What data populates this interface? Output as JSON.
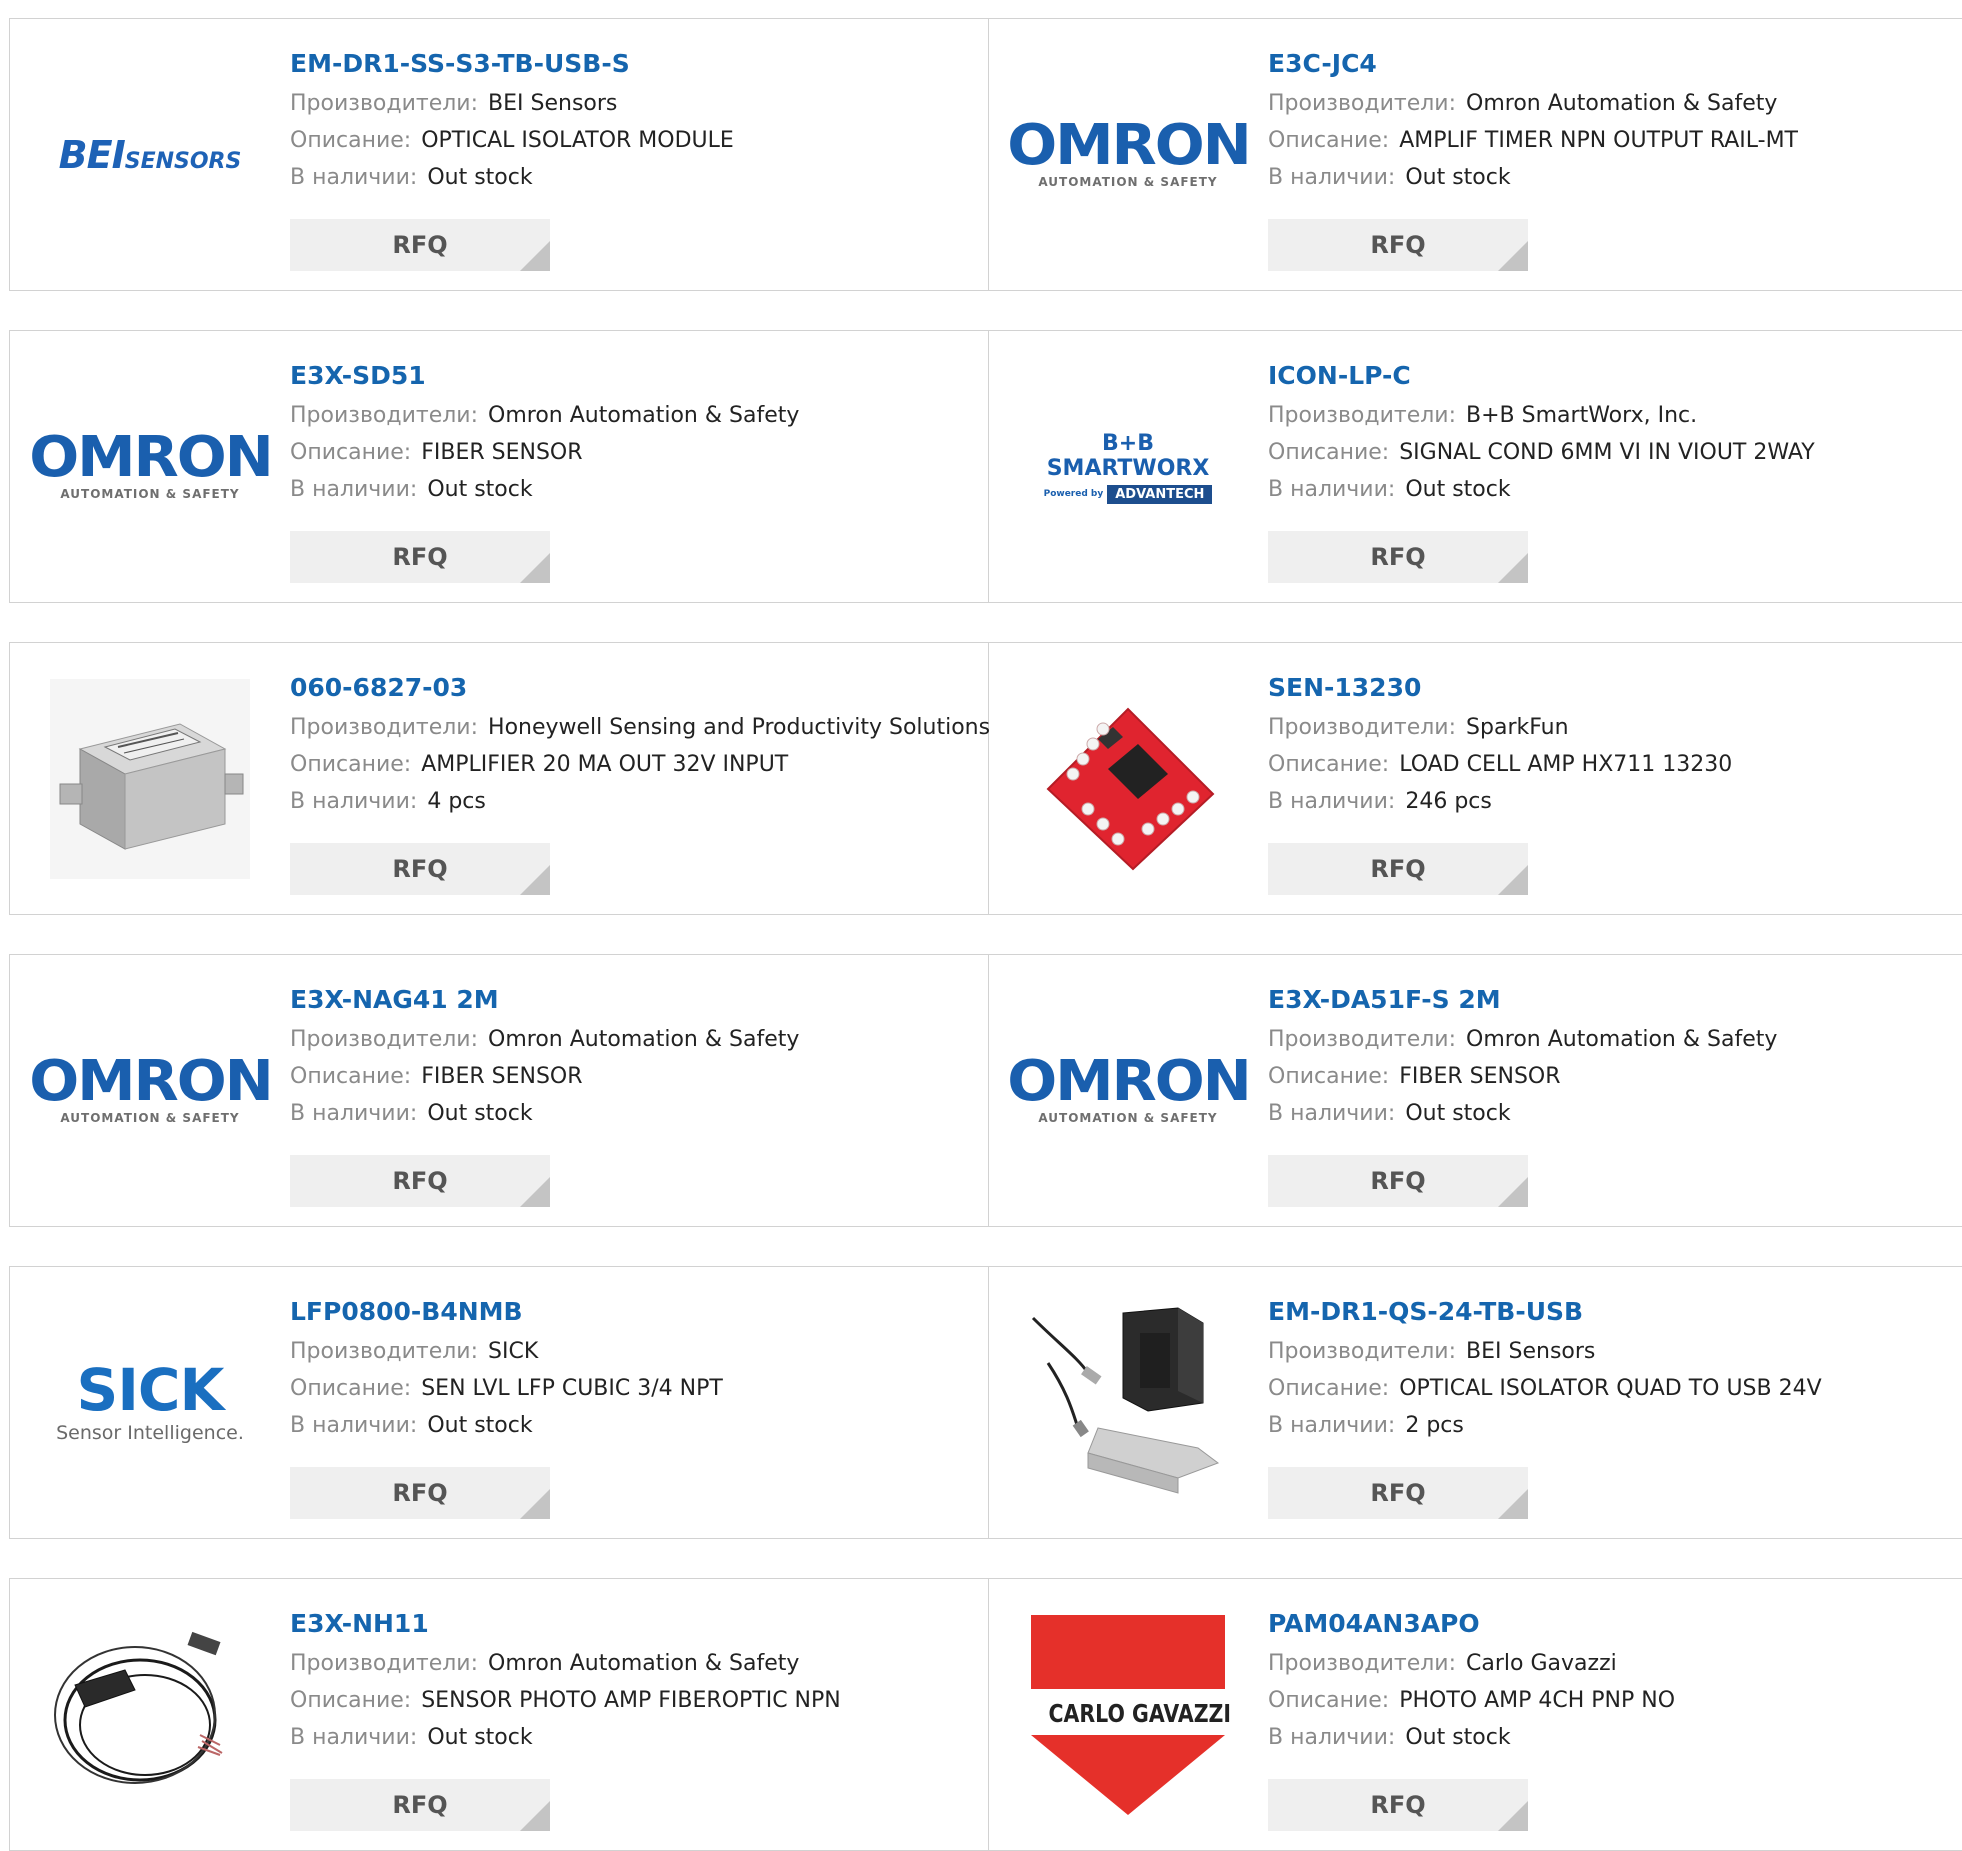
{
  "labels": {
    "manufacturer": "Производители:",
    "description": "Описание:",
    "stock": "В наличии:",
    "rfq": "RFQ"
  },
  "products": [
    {
      "part": "EM-DR1-SS-S3-TB-USB-S",
      "manufacturer": "BEI Sensors",
      "description": "OPTICAL ISOLATOR MODULE",
      "stock": "Out stock",
      "logo": "bei-sensors-logo",
      "logo_text": [
        "BEI",
        "SENSORS"
      ]
    },
    {
      "part": "E3C-JC4",
      "manufacturer": "Omron Automation & Safety",
      "description": "AMPLIF TIMER NPN OUTPUT RAIL-MT",
      "stock": "Out stock",
      "logo": "omron-logo",
      "logo_text": [
        "OMRON",
        "AUTOMATION & SAFETY"
      ]
    },
    {
      "part": "E3X-SD51",
      "manufacturer": "Omron Automation & Safety",
      "description": "FIBER SENSOR",
      "stock": "Out stock",
      "logo": "omron-logo",
      "logo_text": [
        "OMRON",
        "AUTOMATION & SAFETY"
      ]
    },
    {
      "part": "ICON-LP-C",
      "manufacturer": "B+B SmartWorx, Inc.",
      "description": "SIGNAL COND 6MM VI IN VIOUT 2WAY",
      "stock": "Out stock",
      "logo": "bb-smartworx-logo",
      "logo_text": [
        "B+B SMARTWORX",
        "Powered by",
        "ADVANTECH"
      ]
    },
    {
      "part": "060-6827-03",
      "manufacturer": "Honeywell Sensing and Productivity Solutions",
      "description": "AMPLIFIER 20 MA OUT 32V INPUT",
      "stock": "4 pcs",
      "logo": "junction-box-image",
      "logo_text": []
    },
    {
      "part": "SEN-13230",
      "manufacturer": "SparkFun",
      "description": "LOAD CELL AMP HX711 13230",
      "stock": "246 pcs",
      "logo": "red-pcb-board-image",
      "logo_text": []
    },
    {
      "part": "E3X-NAG41 2M",
      "manufacturer": "Omron Automation & Safety",
      "description": "FIBER SENSOR",
      "stock": "Out stock",
      "logo": "omron-logo",
      "logo_text": [
        "OMRON",
        "AUTOMATION & SAFETY"
      ]
    },
    {
      "part": "E3X-DA51F-S 2M",
      "manufacturer": "Omron Automation & Safety",
      "description": "FIBER SENSOR",
      "stock": "Out stock",
      "logo": "omron-logo",
      "logo_text": [
        "OMRON",
        "AUTOMATION & SAFETY"
      ]
    },
    {
      "part": "LFP0800-B4NMB",
      "manufacturer": "SICK",
      "description": "SEN LVL LFP CUBIC 3/4 NPT",
      "stock": "Out stock",
      "logo": "sick-logo",
      "logo_text": [
        "SICK",
        "Sensor Intelligence."
      ]
    },
    {
      "part": "EM-DR1-QS-24-TB-USB",
      "manufacturer": "BEI Sensors",
      "description": "OPTICAL ISOLATOR QUAD TO USB 24V",
      "stock": "2 pcs",
      "logo": "din-rail-module-image",
      "logo_text": []
    },
    {
      "part": "E3X-NH11",
      "manufacturer": "Omron Automation & Safety",
      "description": "SENSOR PHOTO AMP FIBEROPTIC NPN",
      "stock": "Out stock",
      "logo": "fiber-sensor-cable-image",
      "logo_text": []
    },
    {
      "part": "PAM04AN3APO",
      "manufacturer": "Carlo Gavazzi",
      "description": "PHOTO AMP 4CH PNP NO",
      "stock": "Out stock",
      "logo": "carlo-gavazzi-logo",
      "logo_text": [
        "CARLO GAVAZZI"
      ]
    }
  ]
}
